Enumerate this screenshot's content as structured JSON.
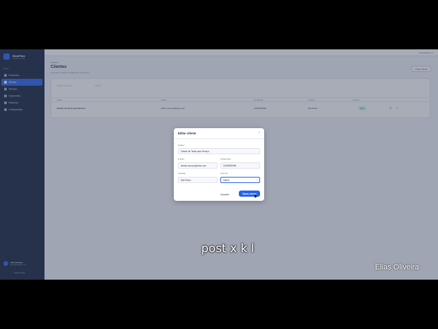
{
  "sidebar": {
    "brand": "ObraFlow",
    "brand_sub": "Gestão de obras",
    "menu_heading": "MENU",
    "items": [
      {
        "label": "Dashboard",
        "icon": "dashboard-icon"
      },
      {
        "label": "Clientes",
        "icon": "users-icon",
        "active": true
      },
      {
        "label": "Serviços",
        "icon": "tools-icon"
      },
      {
        "label": "Orçamentos",
        "icon": "file-icon"
      },
      {
        "label": "Relatórios",
        "icon": "chart-icon"
      },
      {
        "label": "Configurações",
        "icon": "gear-icon"
      }
    ],
    "user_name": "Administrador",
    "user_email": "admin@obraflow.com",
    "logout": "← Sair da conta"
  },
  "topbar": {
    "user": "Administrador ▾"
  },
  "header": {
    "breadcrumb": "Cadastros",
    "title": "Clientes",
    "subtitle": "Gerencie os clientes cadastrados no sistema",
    "new_button": "+ Novo cliente"
  },
  "filters": {
    "search_placeholder": "Buscar por nome...",
    "status_filter": "Todos"
  },
  "table": {
    "columns": [
      "NOME",
      "E-MAIL",
      "TELEFONE",
      "CIDADE",
      "STATUS"
    ],
    "rows": [
      {
        "name": "Cliente de Teste para Serviço",
        "email": "cliente.servico@teste.com",
        "phone": "11999999999",
        "city": "São Paulo",
        "status": "Ativo"
      }
    ]
  },
  "modal": {
    "title": "Editar cliente",
    "close": "×",
    "name_label": "NOME *",
    "name_value": "Cliente de Teste para Serviço",
    "email_label": "E-MAIL",
    "email_value": "cliente.servico@teste.com",
    "phone_label": "TELEFONE",
    "phone_value": "11999999999",
    "city_label": "CIDADE",
    "city_value": "São Paulo",
    "status_label": "STATUS",
    "status_value": "Inativo",
    "cancel": "Cancelar",
    "save": "Salvar cliente"
  },
  "caption": "post x k l",
  "watermark": "Elias Oliveira",
  "colors": {
    "sidebar": "#14213d",
    "accent": "#2563eb",
    "badge_bg": "#d8f3e0",
    "badge_text": "#1f8a4c"
  }
}
